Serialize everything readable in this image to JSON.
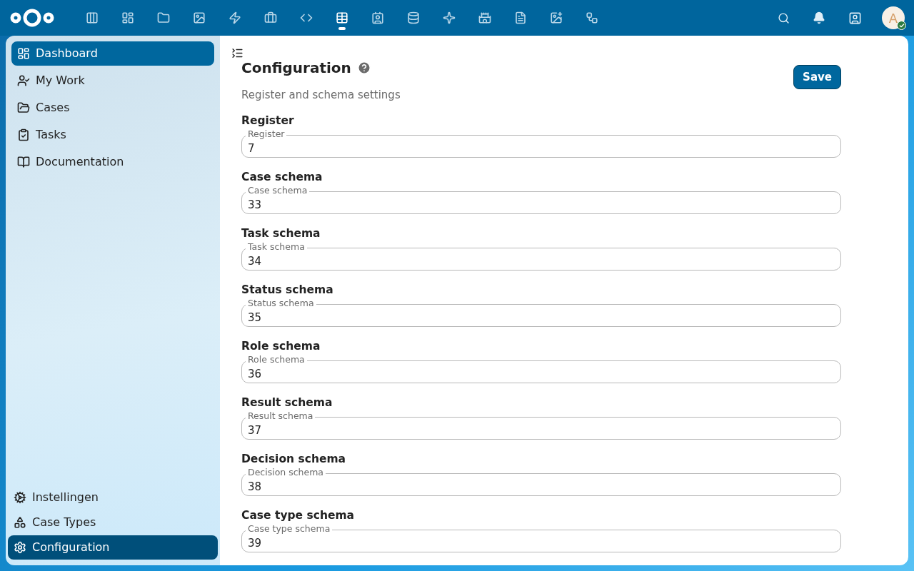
{
  "top_bar": {
    "apps": [
      {
        "kind": "columns",
        "selected": false
      },
      {
        "kind": "dashboard",
        "selected": false
      },
      {
        "kind": "files",
        "selected": false
      },
      {
        "kind": "photos",
        "selected": false
      },
      {
        "kind": "activity",
        "selected": false
      },
      {
        "kind": "bag",
        "selected": false
      },
      {
        "kind": "code",
        "selected": false
      },
      {
        "kind": "tables",
        "selected": true
      },
      {
        "kind": "contacts",
        "selected": false
      },
      {
        "kind": "database",
        "selected": false
      },
      {
        "kind": "star",
        "selected": false
      },
      {
        "kind": "castle",
        "selected": false
      },
      {
        "kind": "document",
        "selected": false
      },
      {
        "kind": "image",
        "selected": false
      },
      {
        "kind": "flow",
        "selected": false
      }
    ],
    "avatar": {
      "initial": "A",
      "online": true
    }
  },
  "sidebar": {
    "items": [
      {
        "kind": "dashboard",
        "label": "Dashboard",
        "selected": true
      },
      {
        "kind": "mywork",
        "label": "My Work",
        "selected": false
      },
      {
        "kind": "folder",
        "label": "Cases",
        "selected": false
      },
      {
        "kind": "tasks",
        "label": "Tasks",
        "selected": false
      },
      {
        "kind": "book",
        "label": "Documentation",
        "selected": false
      }
    ],
    "footer_items": [
      {
        "kind": "cog",
        "label": "Instellingen",
        "selected": false
      },
      {
        "kind": "shapes",
        "label": "Case Types",
        "selected": false
      },
      {
        "kind": "gear",
        "label": "Configuration",
        "selected": true
      }
    ]
  },
  "page": {
    "title": "Configuration",
    "subtitle": "Register and schema settings",
    "save_button": "Save",
    "fields": [
      {
        "heading": "Register",
        "label": "Register",
        "value": "7"
      },
      {
        "heading": "Case schema",
        "label": "Case schema",
        "value": "33"
      },
      {
        "heading": "Task schema",
        "label": "Task schema",
        "value": "34"
      },
      {
        "heading": "Status schema",
        "label": "Status schema",
        "value": "35"
      },
      {
        "heading": "Role schema",
        "label": "Role schema",
        "value": "36"
      },
      {
        "heading": "Result schema",
        "label": "Result schema",
        "value": "37"
      },
      {
        "heading": "Decision schema",
        "label": "Decision schema",
        "value": "38"
      },
      {
        "heading": "Case type schema",
        "label": "Case type schema",
        "value": "39"
      }
    ]
  }
}
